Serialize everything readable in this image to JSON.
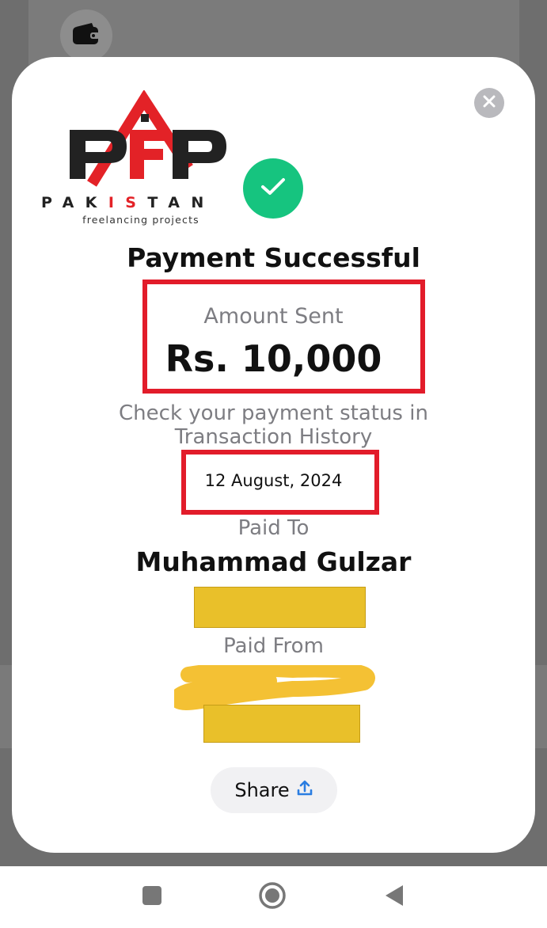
{
  "logo": {
    "word_pre": "PAK",
    "word_red": "IS",
    "word_post": "TAN",
    "tagline": "freelancing projects"
  },
  "dialog": {
    "title": "Payment Successful",
    "amount_label": "Amount Sent",
    "amount_value": "Rs. 10,000",
    "status_line1": "Check your payment status in",
    "status_line2": "Transaction History",
    "date": "12 August, 2024",
    "paid_to_label": "Paid To",
    "payee_name": "Muhammad Gulzar",
    "paid_from_label": "Paid From",
    "share_label": "Share"
  },
  "icons": {
    "close": "close-icon",
    "success": "checkmark-icon",
    "share": "upload-icon",
    "wallet": "wallet-icon",
    "nav_recents": "square-icon",
    "nav_home": "circle-icon",
    "nav_back": "triangle-back-icon"
  },
  "colors": {
    "success_green": "#16c47f",
    "highlight_red": "#e21c2a",
    "redaction_yellow": "#e9c02a",
    "share_blue": "#2a7de1"
  }
}
